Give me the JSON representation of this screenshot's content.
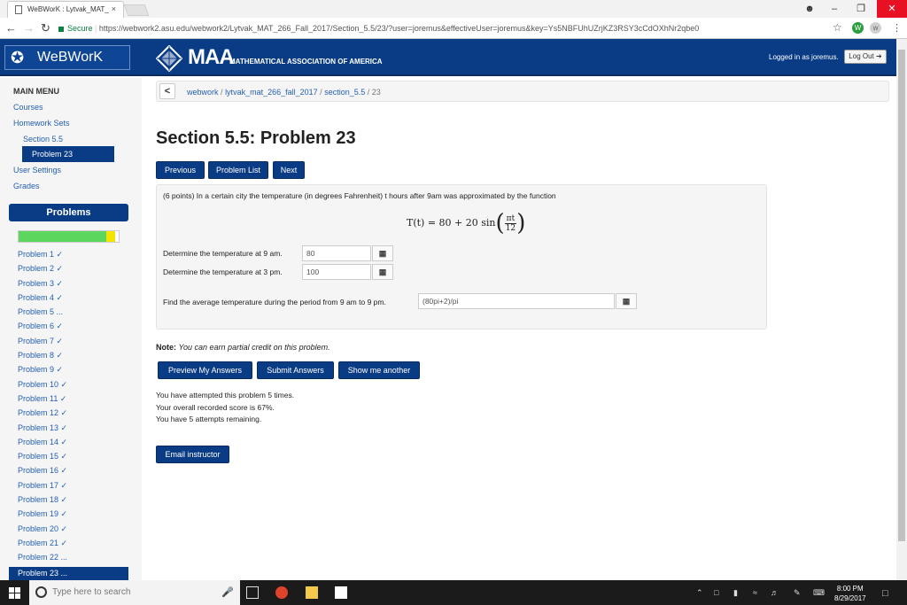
{
  "browser": {
    "tab_title": "WeBWorK : Lytvak_MAT_",
    "tab_close": "×",
    "secure_label": "Secure",
    "url": "https://webwork2.asu.edu/webwork2/Lytvak_MAT_266_Fall_2017/Section_5.5/23/?user=joremus&effectiveUser=joremus&key=Ys5NBFUhUZrjKZ3RSY3cCdOXhNr2qbe0",
    "back_icon": "arrow-left-icon",
    "forward_icon": "arrow-right-icon",
    "reload_icon": "reload-icon"
  },
  "header": {
    "app_name": "WeBWorK",
    "maa_big": "MAA",
    "maa_small": "MATHEMATICAL ASSOCIATION OF AMERICA",
    "logged_in": "Logged in as joremus.",
    "logout_label": "Log Out"
  },
  "sidebar": {
    "main_menu": "MAIN MENU",
    "courses": "Courses",
    "homework_sets": "Homework Sets",
    "section": "Section 5.5",
    "problem_active": "Problem 23",
    "user_settings": "User Settings",
    "grades": "Grades",
    "problems_heading": "Problems",
    "progress_complete_fraction": 0.88,
    "progress_partial_fraction": 0.09,
    "problems": [
      "Problem 1 ✓",
      "Problem 2 ✓",
      "Problem 3 ✓",
      "Problem 4 ✓",
      "Problem 5 ...",
      "Problem 6 ✓",
      "Problem 7 ✓",
      "Problem 8 ✓",
      "Problem 9 ✓",
      "Problem 10 ✓",
      "Problem 11 ✓",
      "Problem 12 ✓",
      "Problem 13 ✓",
      "Problem 14 ✓",
      "Problem 15 ✓",
      "Problem 16 ✓",
      "Problem 17 ✓",
      "Problem 18 ✓",
      "Problem 19 ✓",
      "Problem 20 ✓",
      "Problem 21 ✓",
      "Problem 22 ..."
    ],
    "current_problem": "Problem 23 ..."
  },
  "breadcrumb": {
    "back": "<",
    "root": "webwork",
    "sep": "/",
    "course": "lytvak_mat_266_fall_2017",
    "section": "section_5.5",
    "last": "23"
  },
  "main": {
    "title": "Section 5.5: Problem 23",
    "previous": "Previous",
    "problem_list": "Problem List",
    "next": "Next",
    "problem_text": "(6 points) In a certain city the temperature (in degrees Fahrenheit) t hours after 9am was approximated by the function",
    "formula_lhs": "T(t) = 80 + 20 sin",
    "formula_num": "πt",
    "formula_den": "12",
    "q1_label": "Determine the temperature at 9 am.",
    "q1_value": "80",
    "q2_label": "Determine the temperature at 3 pm.",
    "q2_value": "100",
    "q3_label": "Find the average temperature during the period from 9 am to 9 pm.",
    "q3_value": "(80pi+2)/pi",
    "note_label": "Note:",
    "note_text": "You can earn partial credit on this problem.",
    "preview": "Preview My Answers",
    "submit": "Submit Answers",
    "show_another": "Show me another",
    "attempt_line1": "You have attempted this problem 5 times.",
    "attempt_line2": "Your overall recorded score is 67%.",
    "attempt_line3": "You have 5 attempts remaining.",
    "email": "Email instructor"
  },
  "taskbar": {
    "search_placeholder": "Type here to search",
    "time": "8:00 PM",
    "date": "8/29/2017"
  },
  "colors": {
    "brand_navy": "#0a3c86",
    "link_blue": "#2560b0",
    "progress_green": "#5cd65c",
    "progress_yellow": "#f5e400"
  }
}
